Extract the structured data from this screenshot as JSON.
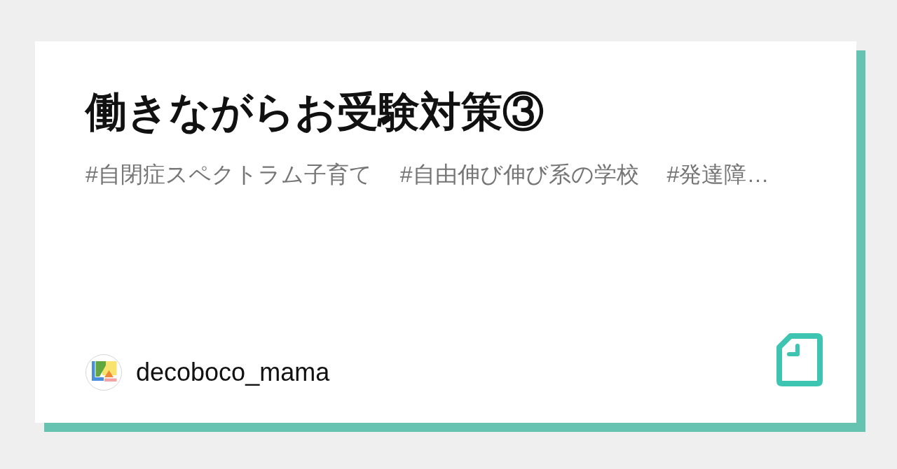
{
  "card": {
    "title": "働きながらお受験対策③",
    "hashtags": [
      "#自閉症スペクトラム子育て",
      "#自由伸び伸び系の学校",
      "#発達障…"
    ],
    "author": {
      "name": "decoboco_mama"
    }
  }
}
